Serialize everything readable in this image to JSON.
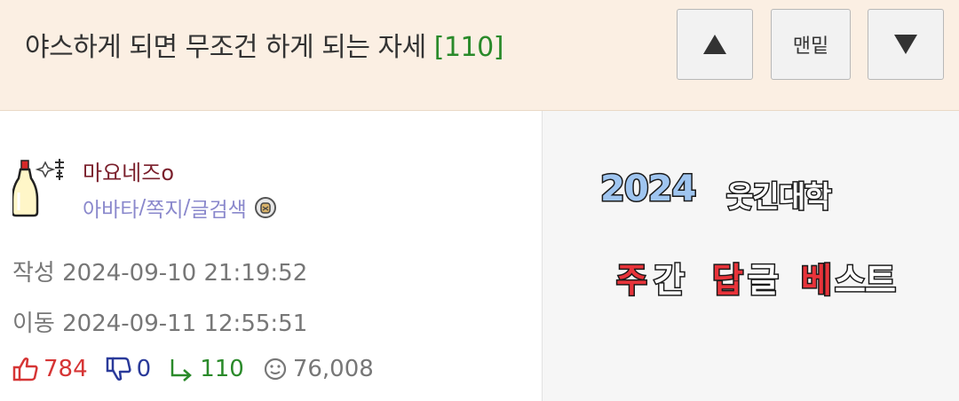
{
  "header": {
    "title": "야스하게 되면 무조건 하게 되는 자세",
    "comment_count": "[110]",
    "bottom_button_label": "맨밑",
    "up_icon": "triangle-up-icon",
    "down_icon": "triangle-down-icon"
  },
  "author": {
    "nickname": "마요네즈o",
    "link_avatar": "아바타",
    "link_message": "쪽지",
    "link_search": "글검색",
    "sep1": "/",
    "sep2": "/"
  },
  "post_meta": {
    "created_label": "작성",
    "created_value": "2024-09-10 21:19:52",
    "moved_label": "이동",
    "moved_value": "2024-09-11 12:55:51"
  },
  "stats": {
    "likes": "784",
    "dislikes": "0",
    "replies": "110",
    "views": "76,008"
  },
  "banner": {
    "year": "2024",
    "org": "웃긴대학",
    "w1": "주",
    "w2": "간",
    "w3": "답",
    "w4": "글",
    "w5": "베",
    "w6": "스트"
  },
  "colors": {
    "header_bg": "#fbefe3",
    "count_green": "#2a8a2a",
    "nick_red": "#7a1f2b",
    "link_purple": "#8a88cc",
    "like_red": "#d63535",
    "dislike_blue": "#2a3a9a",
    "banner_blue": "#9fc5f0",
    "banner_red": "#e8333a"
  }
}
